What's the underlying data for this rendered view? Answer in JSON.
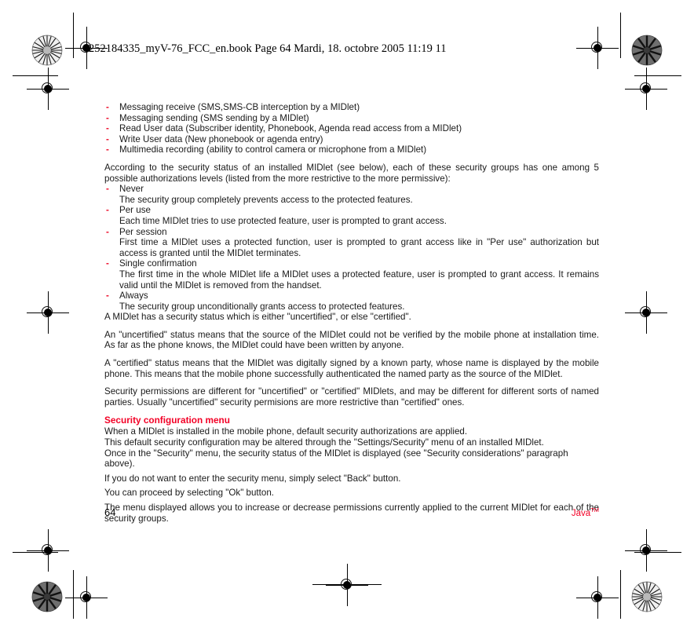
{
  "header": {
    "text": "252184335_myV-76_FCC_en.book  Page 64  Mardi, 18. octobre 2005  11:19 11"
  },
  "content": {
    "permission_groups": [
      "Messaging receive (SMS,SMS-CB interception by a MIDlet)",
      "Messaging sending (SMS sending by a MIDlet)",
      "Read User data (Subscriber identity, Phonebook, Agenda read access from a MIDlet)",
      "Write User data (New phonebook or agenda entry)",
      "Multimedia recording (ability to control camera or microphone from a MIDlet)"
    ],
    "intro_paragraph": "According to the security status of an installed MIDlet (see below), each of these security groups has one among 5 possible authorizations levels (listed from the more restrictive to the more permissive):",
    "authorization_levels": [
      {
        "name": "Never",
        "description": "The security group completely prevents access to the protected features."
      },
      {
        "name": "Per use",
        "description": "Each time MIDlet tries to use protected feature, user is prompted to grant access."
      },
      {
        "name": "Per session",
        "description": "First time a MIDlet uses a protected function, user is prompted to grant access like in \"Per use\" authorization but access is granted until the MIDlet terminates."
      },
      {
        "name": "Single confirmation",
        "description": "The first time in the whole MIDlet life a MIDlet uses a protected feature, user is prompted to grant access. It remains valid until the MIDlet is removed from the handset."
      },
      {
        "name": "Always",
        "description": "The security group unconditionally grants access to protected features."
      }
    ],
    "status_paragraphs": [
      "A MIDlet has a security status which is either \"uncertified\", or else \"certified\".",
      "An \"uncertified\" status means that the source of the MIDlet could not be verified by the mobile phone at installation time. As far as the phone knows, the MIDlet could have been written by anyone.",
      "A \"certified\" status means that the MIDlet was digitally signed by a known party, whose name is displayed by the mobile phone. This means that the mobile phone successfully authenticated the named party as the source of the MIDlet.",
      "Security permissions are different for \"uncertified\" or \"certified\" MIDlets, and may be different for different sorts of named parties. Usually \"uncertified\" security permisions are more restrictive than \"certified\" ones."
    ],
    "section_title": "Security configuration menu",
    "menu_paragraphs": [
      "When a MIDlet is installed in the mobile phone, default security authorizations are applied.",
      "This default security configuration may be altered through the \"Settings/Security\" menu of an installed MIDlet.",
      "Once in the \"Security\" menu, the security status of the MIDlet is displayed (see \"Security considerations\" paragraph above).",
      "If you do not want to enter the security menu, simply select \"Back\" button.",
      "You can proceed by selecting \"Ok\" button.",
      "The menu displayed allows you to increase or decrease permissions currently applied to the current MIDlet for each of the security groups."
    ]
  },
  "footer": {
    "page_number": "64",
    "brand": "Java",
    "trademark": "TM"
  },
  "colors": {
    "accent_red": "#f30026",
    "dash_red": "#ee0d2b",
    "text_black": "#1a1a1a"
  },
  "dash_marker": "-"
}
